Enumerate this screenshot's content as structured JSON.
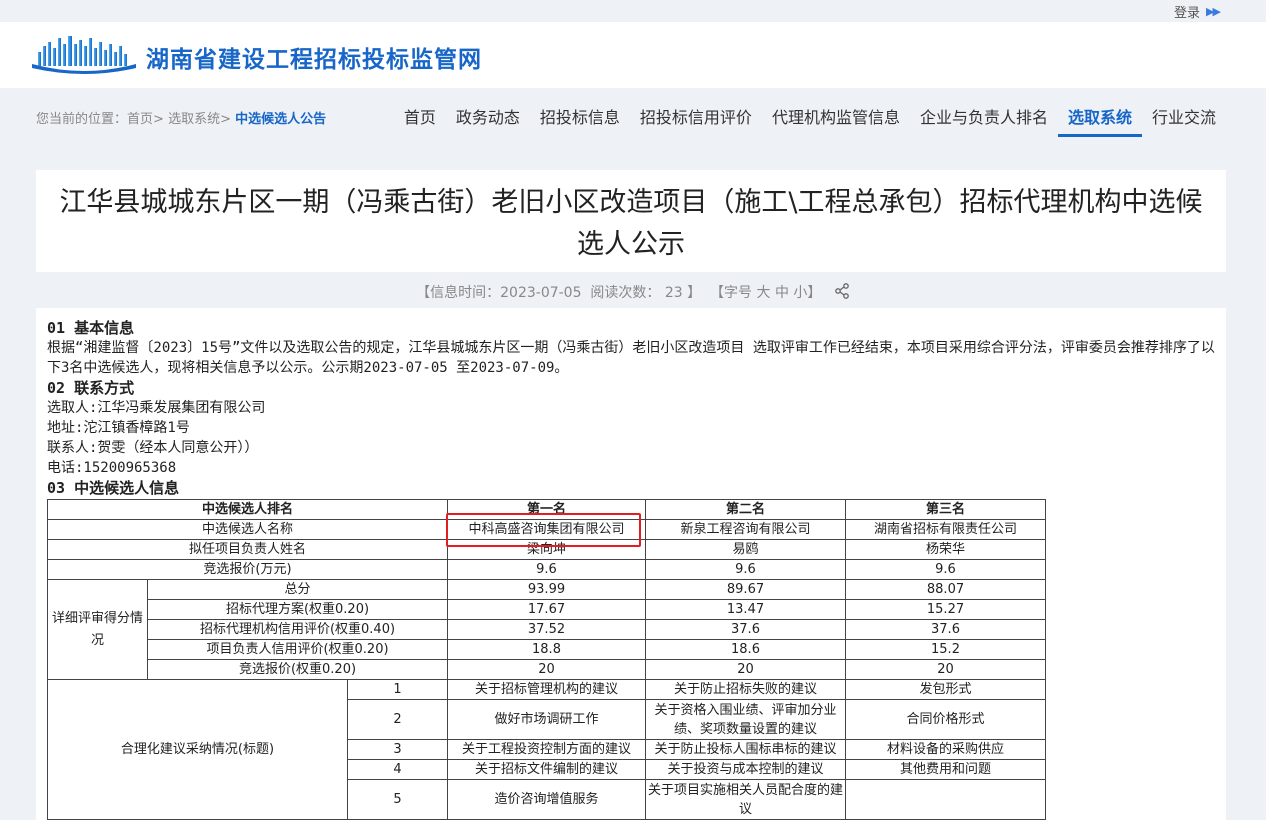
{
  "topbar": {
    "login": "登录"
  },
  "header": {
    "site_title": "湖南省建设工程招标投标监管网"
  },
  "breadcrumb": {
    "prefix": "您当前的位置：",
    "home": "首页",
    "sep1": ">",
    "section": "选取系统",
    "sep2": ">",
    "current": "中选候选人公告"
  },
  "nav": {
    "items": [
      {
        "label": "首页"
      },
      {
        "label": "政务动态"
      },
      {
        "label": "招投标信息"
      },
      {
        "label": "招投标信用评价"
      },
      {
        "label": "代理机构监管信息"
      },
      {
        "label": "企业与负责人排名"
      },
      {
        "label": "选取系统"
      },
      {
        "label": "行业交流"
      }
    ],
    "active_index": 6
  },
  "article": {
    "title": "江华县城城东片区一期（冯乘古街）老旧小区改造项目（施工\\工程总承包）招标代理机构中选候选人公示",
    "meta_time": "【信息时间：2023-07-05",
    "meta_reads": "阅读次数： 23 】",
    "fontsize": {
      "prefix": "【字号",
      "big": "大",
      "mid": "中",
      "small": "小",
      "suffix": "】"
    },
    "sec1_title": "01  基本信息",
    "sec1_body": "根据“湘建监督〔2023〕15号”文件以及选取公告的规定，江华县城城东片区一期（冯乘古街）老旧小区改造项目 选取评审工作已经结束，本项目采用综合评分法，评审委员会推荐排序了以下3名中选候选人，现将相关信息予以公示。公示期2023-07-05 至2023-07-09。",
    "sec2_title": "02  联系方式",
    "contact_selector": "选取人:江华冯乘发展集团有限公司",
    "contact_address": "地址:沱江镇香樟路1号",
    "contact_person": "联系人:贺雯（经本人同意公开））",
    "contact_phone": "电话:15200965368",
    "sec3_title": "03  中选候选人信息"
  },
  "table": {
    "rank_header": "中选候选人排名",
    "ranks": [
      "第一名",
      "第二名",
      "第三名"
    ],
    "name_label": "中选候选人名称",
    "names": [
      "中科高盛咨询集团有限公司",
      "新泉工程咨询有限公司",
      "湖南省招标有限责任公司"
    ],
    "pm_label": "拟任项目负责人姓名",
    "pms": [
      "梁向坤",
      "易鸥",
      "杨荣华"
    ],
    "bid_label": "竞选报价(万元)",
    "bids": [
      "9.6",
      "9.6",
      "9.6"
    ],
    "detail_label": "详细评审得分情况",
    "score_rows": [
      {
        "label": "总分",
        "values": [
          "93.99",
          "89.67",
          "88.07"
        ]
      },
      {
        "label": "招标代理方案(权重0.20)",
        "values": [
          "17.67",
          "13.47",
          "15.27"
        ]
      },
      {
        "label": "招标代理机构信用评价(权重0.40)",
        "values": [
          "37.52",
          "37.6",
          "37.6"
        ]
      },
      {
        "label": "项目负责人信用评价(权重0.20)",
        "values": [
          "18.8",
          "18.6",
          "15.2"
        ]
      },
      {
        "label": "竞选报价(权重0.20)",
        "values": [
          "20",
          "20",
          "20"
        ]
      }
    ],
    "suggest_label": "合理化建议采纳情况(标题)",
    "suggest_rows": [
      {
        "no": "1",
        "values": [
          "关于招标管理机构的建议",
          "关于防止招标失败的建议",
          "发包形式"
        ]
      },
      {
        "no": "2",
        "values": [
          "做好市场调研工作",
          "关于资格入围业绩、评审加分业绩、奖项数量设置的建议",
          "合同价格形式"
        ]
      },
      {
        "no": "3",
        "values": [
          "关于工程投资控制方面的建议",
          "关于防止投标人围标串标的建议",
          "材料设备的采购供应"
        ]
      },
      {
        "no": "4",
        "values": [
          "关于招标文件编制的建议",
          "关于投资与成本控制的建议",
          "其他费用和问题"
        ]
      },
      {
        "no": "5",
        "values": [
          "造价咨询增值服务",
          "关于项目实施相关人员配合度的建议",
          ""
        ]
      }
    ]
  },
  "colors": {
    "brand": "#1766c8",
    "highlight": "#e02020",
    "page_bg": "#eef1f6"
  }
}
